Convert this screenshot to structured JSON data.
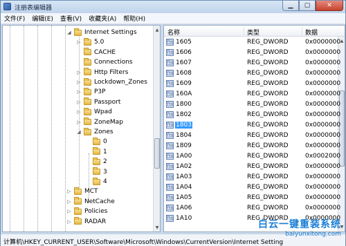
{
  "window": {
    "title": "注册表编辑器"
  },
  "menu": [
    "文件(F)",
    "编辑(E)",
    "查看(V)",
    "收藏夹(A)",
    "帮助(H)"
  ],
  "tree": {
    "items": [
      {
        "label": "Internet Settings",
        "expander": "◢",
        "indent": 0
      },
      {
        "label": "5.0",
        "expander": "▷",
        "indent": 1
      },
      {
        "label": "CACHE",
        "expander": "",
        "indent": 1
      },
      {
        "label": "Connections",
        "expander": "",
        "indent": 1
      },
      {
        "label": "Http Filters",
        "expander": "▷",
        "indent": 1
      },
      {
        "label": "Lockdown_Zones",
        "expander": "▷",
        "indent": 1
      },
      {
        "label": "P3P",
        "expander": "▷",
        "indent": 1
      },
      {
        "label": "Passport",
        "expander": "▷",
        "indent": 1
      },
      {
        "label": "Wpad",
        "expander": "▷",
        "indent": 1
      },
      {
        "label": "ZoneMap",
        "expander": "▷",
        "indent": 1
      },
      {
        "label": "Zones",
        "expander": "◢",
        "indent": 1
      },
      {
        "label": "0",
        "expander": "",
        "indent": 2
      },
      {
        "label": "1",
        "expander": "",
        "indent": 2
      },
      {
        "label": "2",
        "expander": "",
        "indent": 2
      },
      {
        "label": "3",
        "expander": "",
        "indent": 2
      },
      {
        "label": "4",
        "expander": "",
        "indent": 2
      },
      {
        "label": "MCT",
        "expander": "▷",
        "indent": -1
      },
      {
        "label": "NetCache",
        "expander": "▷",
        "indent": -1
      },
      {
        "label": "Policies",
        "expander": "▷",
        "indent": -1
      },
      {
        "label": "RADAR",
        "expander": "▷",
        "indent": -1
      }
    ]
  },
  "list": {
    "headers": {
      "name": "名称",
      "type": "类型",
      "data": "数据"
    },
    "rows": [
      {
        "name": "1605",
        "type": "REG_DWORD",
        "data": "0x0000000"
      },
      {
        "name": "1606",
        "type": "REG_DWORD",
        "data": "0x0000000"
      },
      {
        "name": "1607",
        "type": "REG_DWORD",
        "data": "0x0000000"
      },
      {
        "name": "1608",
        "type": "REG_DWORD",
        "data": "0x0000000"
      },
      {
        "name": "1609",
        "type": "REG_DWORD",
        "data": "0x0000000"
      },
      {
        "name": "160A",
        "type": "REG_DWORD",
        "data": "0x0000000"
      },
      {
        "name": "1800",
        "type": "REG_DWORD",
        "data": "0x0000000"
      },
      {
        "name": "1802",
        "type": "REG_DWORD",
        "data": "0x0000000"
      },
      {
        "name": "1803",
        "type": "REG_DWORD",
        "data": "0x0000000"
      },
      {
        "name": "1804",
        "type": "REG_DWORD",
        "data": "0x0000000"
      },
      {
        "name": "1809",
        "type": "REG_DWORD",
        "data": "0x0000000"
      },
      {
        "name": "1A00",
        "type": "REG_DWORD",
        "data": "0x0002000"
      },
      {
        "name": "1A02",
        "type": "REG_DWORD",
        "data": "0x0000000"
      },
      {
        "name": "1A03",
        "type": "REG_DWORD",
        "data": "0x0000000"
      },
      {
        "name": "1A04",
        "type": "REG_DWORD",
        "data": "0x0000000"
      },
      {
        "name": "1A05",
        "type": "REG_DWORD",
        "data": "0x0000000"
      },
      {
        "name": "1A06",
        "type": "REG_DWORD",
        "data": "0x0000000"
      },
      {
        "name": "1A10",
        "type": "REG_DWORD",
        "data": "0x0000000"
      }
    ],
    "selected_index": 8
  },
  "status": {
    "path": "计算机\\HKEY_CURRENT_USER\\Software\\Microsoft\\Windows\\CurrentVersion\\Internet Setting"
  },
  "watermark": {
    "cn": "白云一键重装系统",
    "en": "baiyunxitong.com"
  }
}
